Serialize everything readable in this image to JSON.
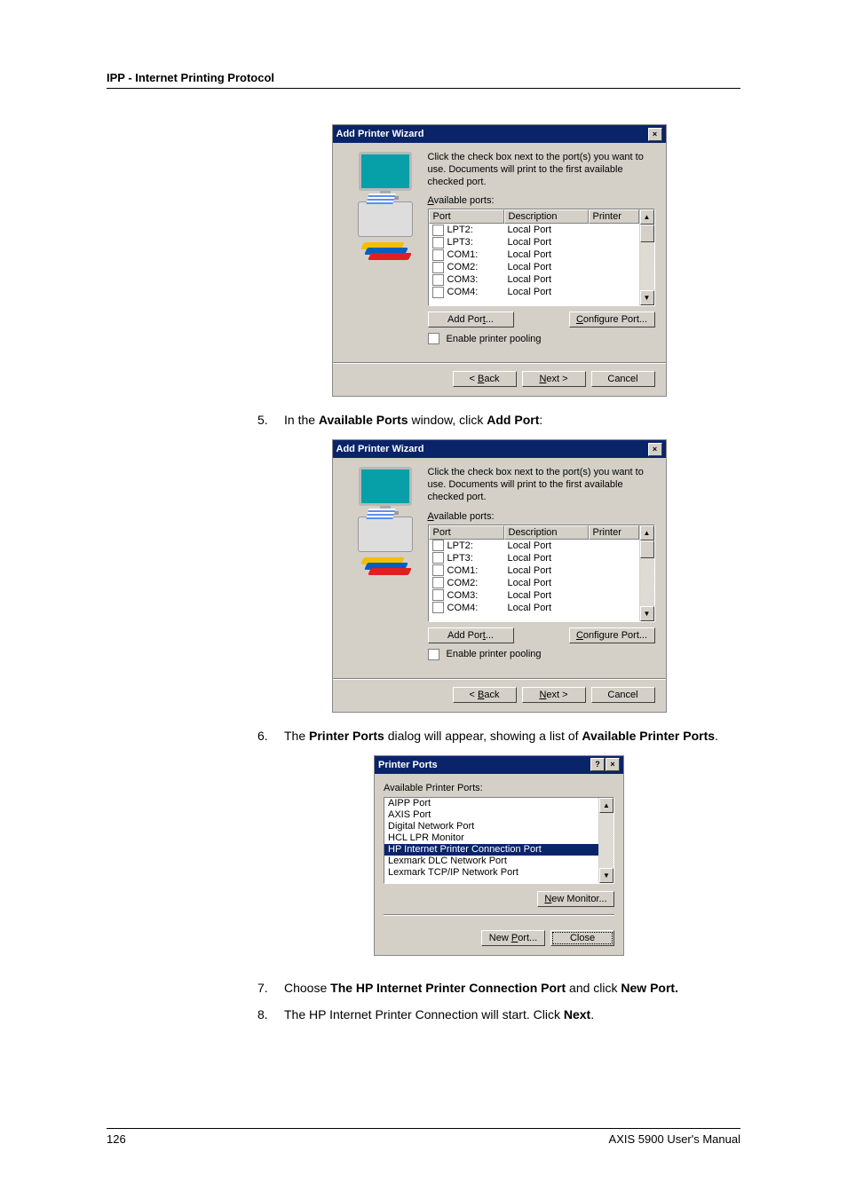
{
  "page": {
    "header": "IPP - Internet Printing Protocol",
    "number": "126",
    "manual": "AXIS 5900 User's Manual"
  },
  "step5": {
    "num": "5.",
    "pre": "In the ",
    "b1": "Available Ports",
    "mid": " window, click ",
    "b2": "Add Port",
    "post": ":"
  },
  "step6": {
    "num": "6.",
    "pre": "The ",
    "b1": "Printer Ports",
    "mid": " dialog will appear, showing a list of ",
    "b2": "Available Printer Ports",
    "post": "."
  },
  "step7": {
    "num": "7.",
    "pre": "Choose ",
    "b1": "The HP Internet Printer Connection Port",
    "mid": " and click ",
    "b2": "New Port."
  },
  "step8": {
    "num": "8.",
    "pre": "The HP Internet Printer Connection will start. Click ",
    "b1": "Next",
    "post": "."
  },
  "wizard": {
    "title": "Add Printer Wizard",
    "hint": "Click the check box next to the port(s) you want to use. Documents will print to the first available checked port.",
    "availLabelPre": "A",
    "availLabelRest": "vailable ports:",
    "headers": {
      "port": "Port",
      "desc": "Description",
      "printer": "Printer"
    },
    "rows": [
      {
        "port": "LPT2:",
        "desc": "Local Port"
      },
      {
        "port": "LPT3:",
        "desc": "Local Port"
      },
      {
        "port": "COM1:",
        "desc": "Local Port"
      },
      {
        "port": "COM2:",
        "desc": "Local Port"
      },
      {
        "port": "COM3:",
        "desc": "Local Port"
      },
      {
        "port": "COM4:",
        "desc": "Local Port"
      }
    ],
    "addPortPre": "Add Por",
    "addPortU": "t",
    "addPortPost": "...",
    "configureU": "C",
    "configurePost": "onfigure Port...",
    "enableU": "E",
    "enablePost": "nable printer pooling",
    "backPre": "< ",
    "backU": "B",
    "backPost": "ack",
    "nextU": "N",
    "nextPost": "ext >",
    "cancel": "Cancel"
  },
  "printerPorts": {
    "title": "Printer Ports",
    "labelU": "A",
    "labelRest": "vailable Printer Ports:",
    "items": [
      "AIPP Port",
      "AXIS Port",
      "Digital Network Port",
      "HCL LPR Monitor",
      "HP Internet Printer Connection Port",
      "Lexmark DLC Network Port",
      "Lexmark TCP/IP Network Port"
    ],
    "selectedIndex": 4,
    "newMonitorU": "N",
    "newMonitorPost": "ew Monitor...",
    "newPortPre": "New ",
    "newPortU": "P",
    "newPortPost": "ort...",
    "close": "Close"
  }
}
